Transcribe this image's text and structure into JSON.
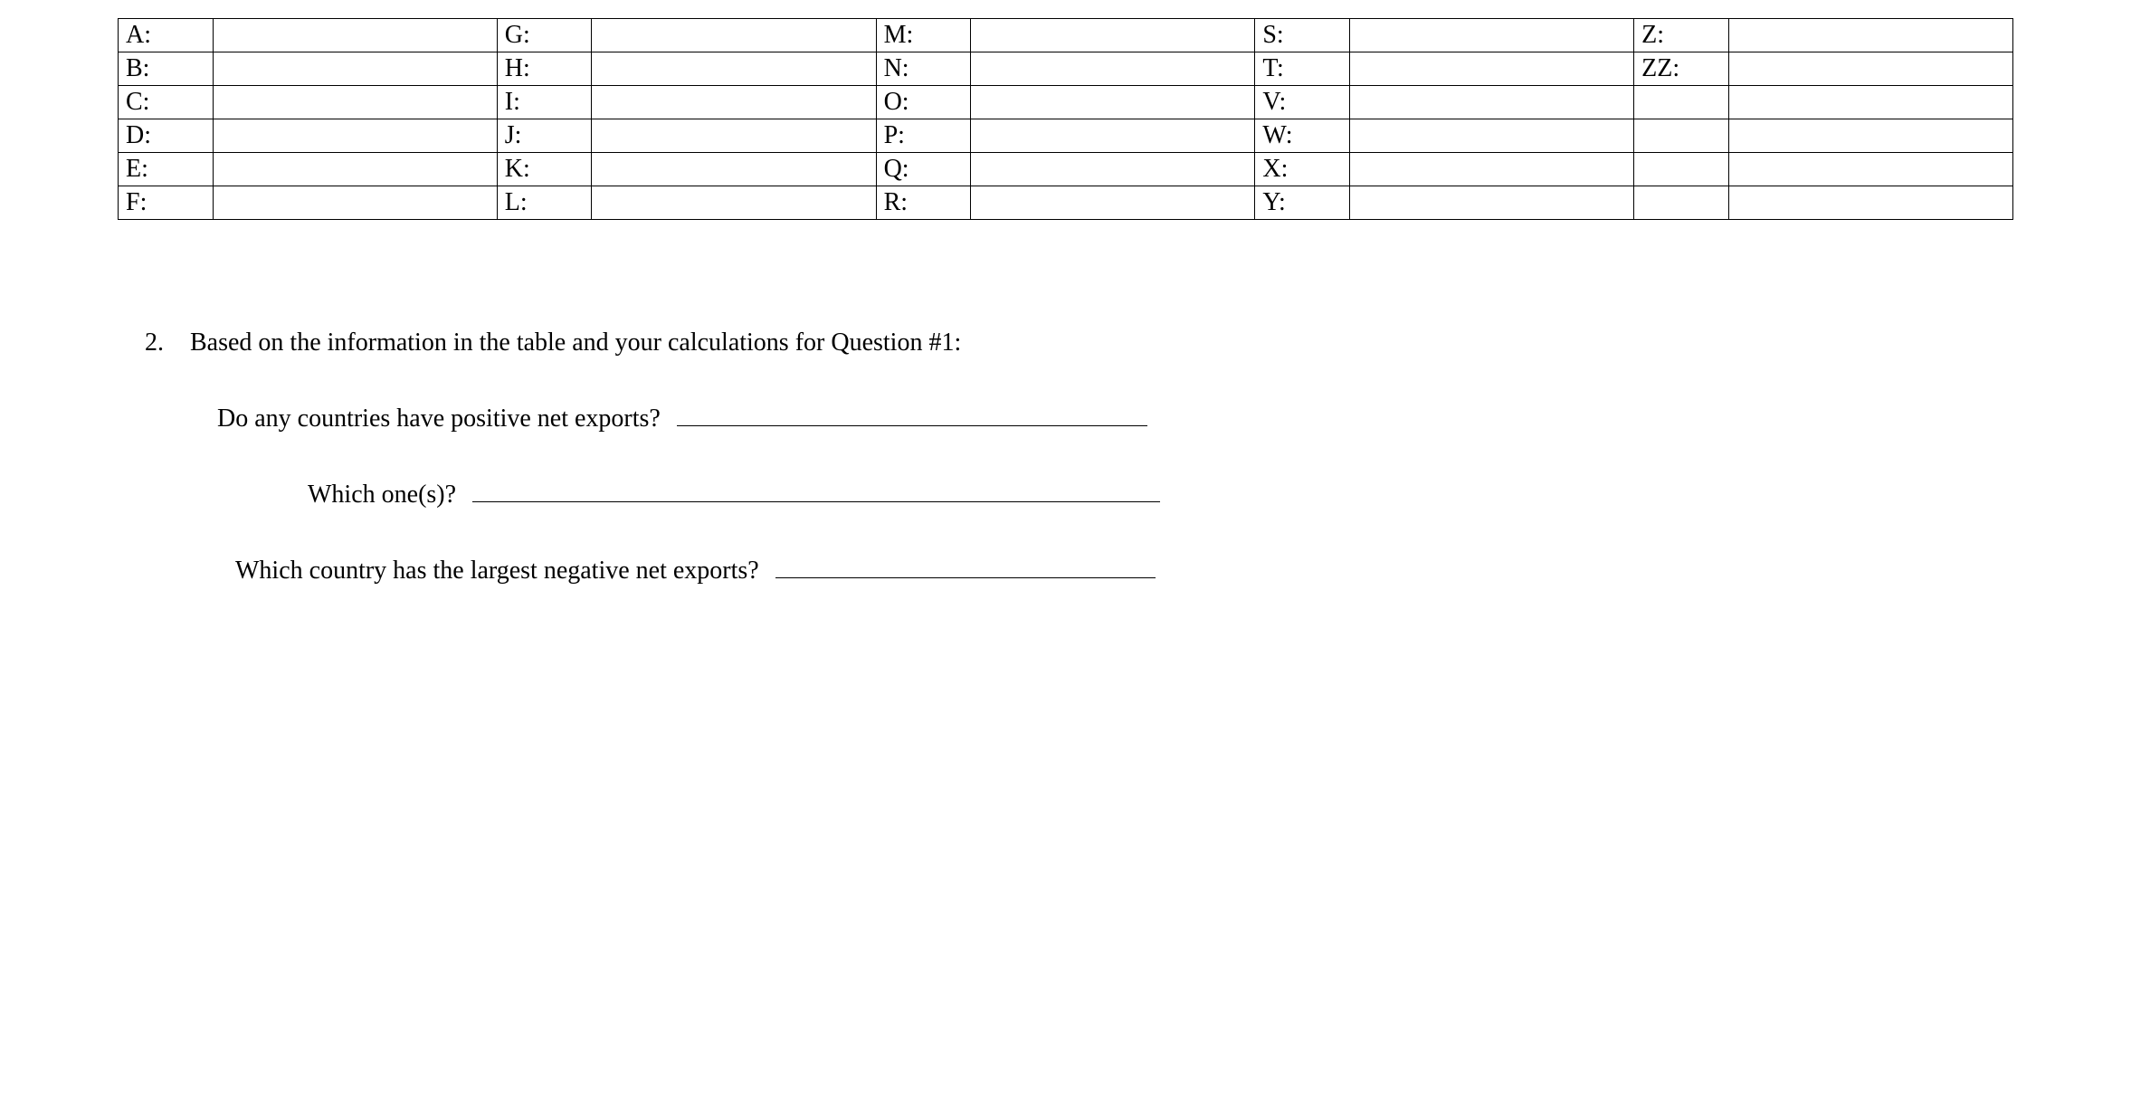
{
  "table": {
    "rows": [
      [
        {
          "label": "A:",
          "value": ""
        },
        {
          "label": "G:",
          "value": ""
        },
        {
          "label": "M:",
          "value": ""
        },
        {
          "label": "S:",
          "value": ""
        },
        {
          "label": "Z:",
          "value": ""
        }
      ],
      [
        {
          "label": "B:",
          "value": ""
        },
        {
          "label": "H:",
          "value": ""
        },
        {
          "label": "N:",
          "value": ""
        },
        {
          "label": "T:",
          "value": ""
        },
        {
          "label": "ZZ:",
          "value": ""
        }
      ],
      [
        {
          "label": "C:",
          "value": ""
        },
        {
          "label": "I:",
          "value": ""
        },
        {
          "label": "O:",
          "value": ""
        },
        {
          "label": "V:",
          "value": ""
        },
        {
          "label": "",
          "value": ""
        }
      ],
      [
        {
          "label": "D:",
          "value": ""
        },
        {
          "label": "J:",
          "value": ""
        },
        {
          "label": "P:",
          "value": ""
        },
        {
          "label": "W:",
          "value": ""
        },
        {
          "label": "",
          "value": ""
        }
      ],
      [
        {
          "label": "E:",
          "value": ""
        },
        {
          "label": "K:",
          "value": ""
        },
        {
          "label": "Q:",
          "value": ""
        },
        {
          "label": "X:",
          "value": ""
        },
        {
          "label": "",
          "value": ""
        }
      ],
      [
        {
          "label": "F:",
          "value": ""
        },
        {
          "label": "L:",
          "value": ""
        },
        {
          "label": "R:",
          "value": ""
        },
        {
          "label": "Y:",
          "value": ""
        },
        {
          "label": "",
          "value": ""
        }
      ]
    ]
  },
  "question": {
    "number": "2.",
    "prompt": "Based on the information in the table and your calculations for Question #1:",
    "lines": {
      "a": "Do any countries have positive net exports?",
      "b": "Which one(s)?",
      "c": "Which country has the largest negative net exports?"
    }
  }
}
